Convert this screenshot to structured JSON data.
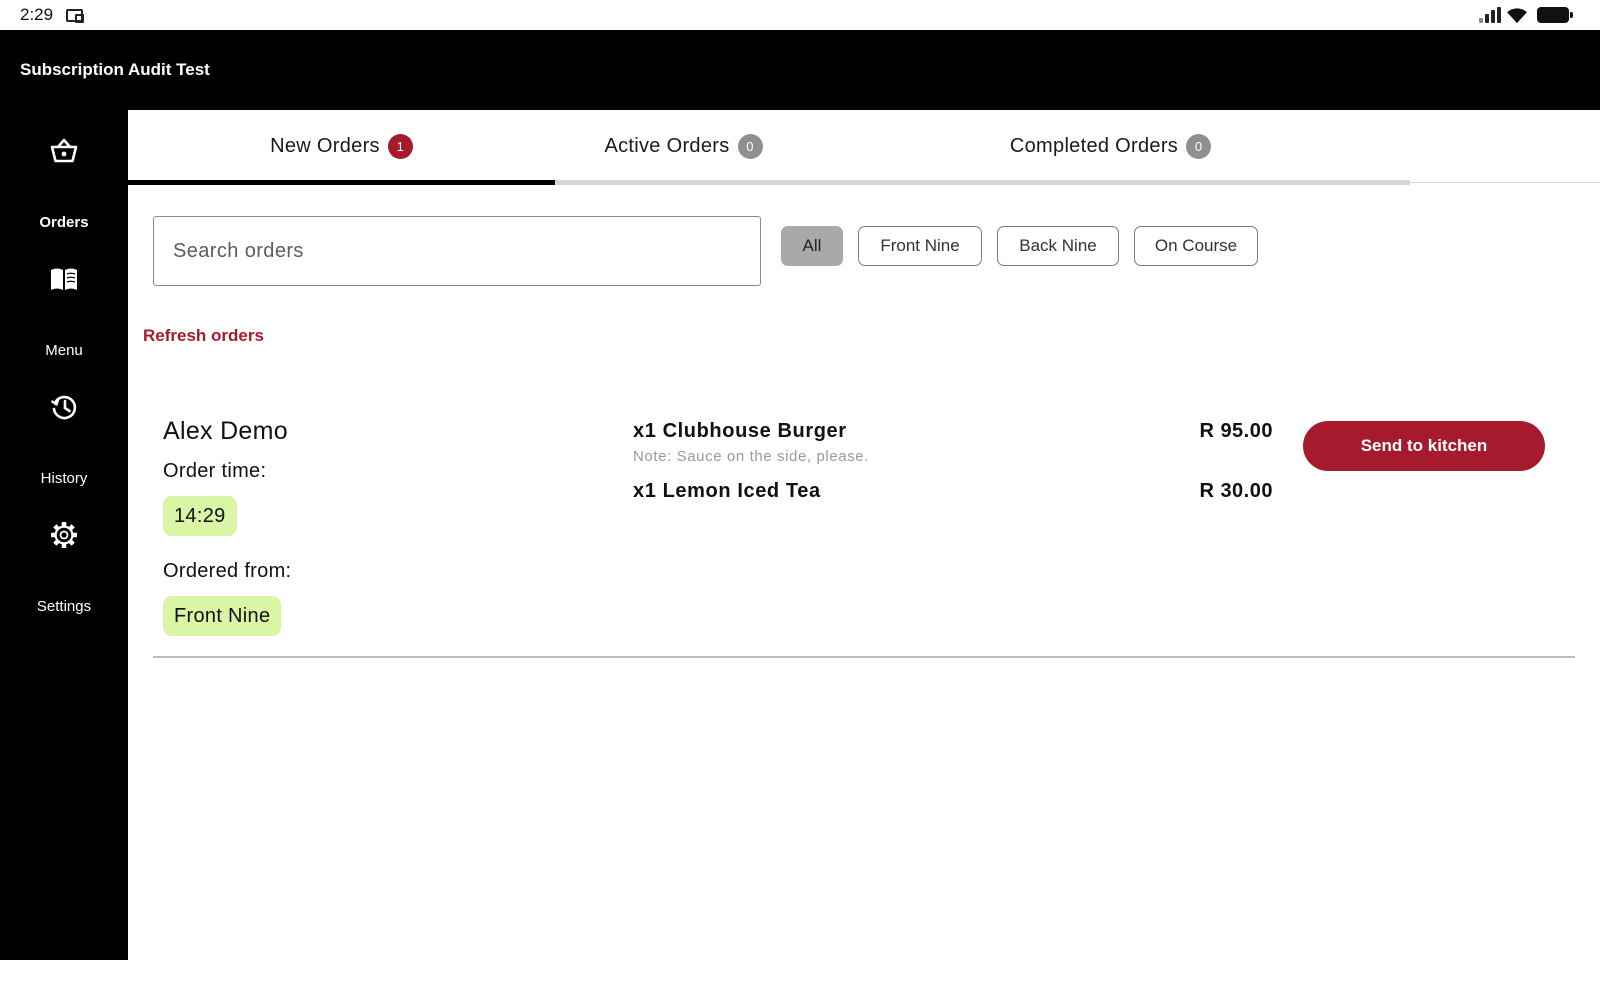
{
  "status_bar": {
    "time": "2:29",
    "icons": [
      "cast-icon",
      "signal-icon",
      "wifi-icon",
      "battery-icon"
    ]
  },
  "app": {
    "title": "Subscription Audit Test"
  },
  "sidebar": {
    "items": [
      {
        "label": "Orders",
        "icon": "basket-icon",
        "active": true
      },
      {
        "label": "Menu",
        "icon": "menu-book-icon",
        "active": false
      },
      {
        "label": "History",
        "icon": "history-icon",
        "active": false
      },
      {
        "label": "Settings",
        "icon": "gear-icon",
        "active": false
      }
    ]
  },
  "tabs": [
    {
      "label": "New Orders",
      "count": "1",
      "active": true
    },
    {
      "label": "Active Orders",
      "count": "0",
      "active": false
    },
    {
      "label": "Completed Orders",
      "count": "0",
      "active": false
    }
  ],
  "search": {
    "placeholder": "Search orders",
    "value": ""
  },
  "filters": [
    {
      "label": "All",
      "selected": true
    },
    {
      "label": "Front Nine",
      "selected": false
    },
    {
      "label": "Back Nine",
      "selected": false
    },
    {
      "label": "On Course",
      "selected": false
    }
  ],
  "refresh_label": "Refresh orders",
  "order": {
    "customer": "Alex Demo",
    "order_time_label": "Order time:",
    "order_time": "14:29",
    "ordered_from_label": "Ordered from:",
    "ordered_from": "Front Nine",
    "items": [
      {
        "name": "x1 Clubhouse Burger",
        "note": "Note: Sauce on the side, please.",
        "price": "R 95.00"
      },
      {
        "name": "x1 Lemon Iced Tea",
        "note": "",
        "price": "R 30.00"
      }
    ],
    "action_label": "Send to kitchen"
  },
  "colors": {
    "accent": "#a51a2d",
    "pill_bg": "#d9f5a6",
    "chip_selected": "#a9a9a9",
    "sidebar_bg": "#000000"
  }
}
